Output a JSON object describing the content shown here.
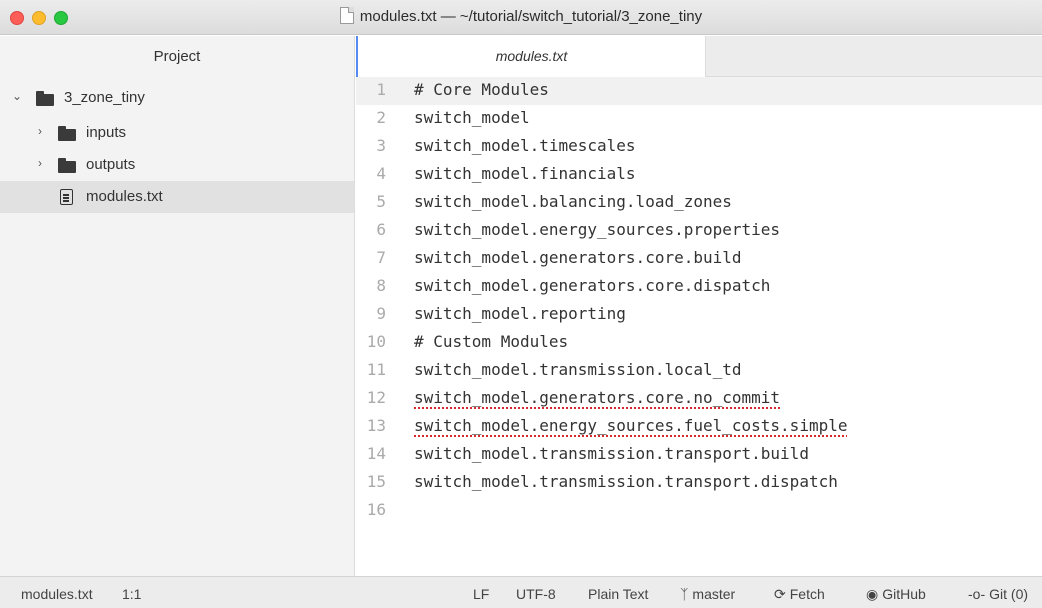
{
  "window": {
    "title": "modules.txt — ~/tutorial/switch_tutorial/3_zone_tiny",
    "accent_color": "#568af2"
  },
  "sidebar": {
    "header": "Project",
    "tree": [
      {
        "name": "3_zone_tiny",
        "type": "folder",
        "expanded": true
      },
      {
        "name": "inputs",
        "type": "folder",
        "expanded": false
      },
      {
        "name": "outputs",
        "type": "folder",
        "expanded": false
      },
      {
        "name": "modules.txt",
        "type": "file",
        "selected": true
      }
    ]
  },
  "tabs": [
    {
      "label": "modules.txt",
      "active": true
    }
  ],
  "editor": {
    "lines": [
      {
        "n": "1",
        "text": "# Core Modules"
      },
      {
        "n": "2",
        "text": "switch_model"
      },
      {
        "n": "3",
        "text": "switch_model.timescales"
      },
      {
        "n": "4",
        "text": "switch_model.financials"
      },
      {
        "n": "5",
        "text": "switch_model.balancing.load_zones"
      },
      {
        "n": "6",
        "text": "switch_model.energy_sources.properties"
      },
      {
        "n": "7",
        "text": "switch_model.generators.core.build"
      },
      {
        "n": "8",
        "text": "switch_model.generators.core.dispatch"
      },
      {
        "n": "9",
        "text": "switch_model.reporting"
      },
      {
        "n": "10",
        "text": "# Custom Modules"
      },
      {
        "n": "11",
        "text": "switch_model.transmission.local_td"
      },
      {
        "n": "12",
        "text": "switch_model.generators.core.no_commit"
      },
      {
        "n": "13",
        "text": "switch_model.energy_sources.fuel_costs.simple"
      },
      {
        "n": "14",
        "text": "switch_model.transmission.transport.build"
      },
      {
        "n": "15",
        "text": "switch_model.transmission.transport.dispatch"
      },
      {
        "n": "16",
        "text": ""
      }
    ]
  },
  "status": {
    "file": "modules.txt",
    "cursor": "1:1",
    "line_ending": "LF",
    "encoding": "UTF-8",
    "grammar": "Plain Text",
    "branch": "master",
    "fetch": "Fetch",
    "github": "GitHub",
    "git": "Git (0)"
  }
}
